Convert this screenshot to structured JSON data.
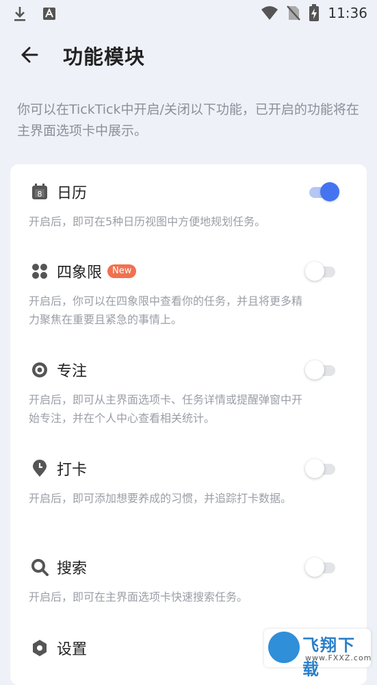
{
  "status_bar": {
    "time": "11:36",
    "left_icons": [
      "download-icon",
      "a-text-icon"
    ],
    "right_icons": [
      "wifi-icon",
      "no-sim-icon",
      "battery-charging-icon"
    ]
  },
  "app_bar": {
    "back_icon": "arrow-left-icon",
    "title": "功能模块"
  },
  "intro_text": "你可以在TickTick中开启/关闭以下功能，已开启的功能将在主界面选项卡中展示。",
  "accent_color": "#4474f0",
  "modules": [
    {
      "icon": "calendar-icon",
      "icon_text": "8",
      "title": "日历",
      "badge": "",
      "description": "开启后，即可在5种日历视图中方便地规划任务。",
      "enabled": true
    },
    {
      "icon": "four-dots-icon",
      "title": "四象限",
      "badge": "New",
      "description": "开启后，你可以在四象限中查看你的任务，并且将更多精力聚焦在重要且紧急的事情上。",
      "enabled": false
    },
    {
      "icon": "focus-target-icon",
      "title": "专注",
      "badge": "",
      "description": "开启后，即可从主界面选项卡、任务详情或提醒弹窗中开始专注，并在个人中心查看相关统计。",
      "enabled": false
    },
    {
      "icon": "habit-pin-icon",
      "title": "打卡",
      "badge": "",
      "description": "开启后，即可添加想要养成的习惯，并追踪打卡数据。",
      "enabled": false
    },
    {
      "icon": "search-icon",
      "title": "搜索",
      "badge": "",
      "description": "开启后，即可在主界面选项卡快速搜索任务。",
      "enabled": false
    },
    {
      "icon": "settings-hexagon-icon",
      "title": "设置",
      "badge": "",
      "description": "",
      "enabled": false
    }
  ],
  "watermark": {
    "text": "飞翔下载",
    "sub": "www.FXXZ.com"
  }
}
